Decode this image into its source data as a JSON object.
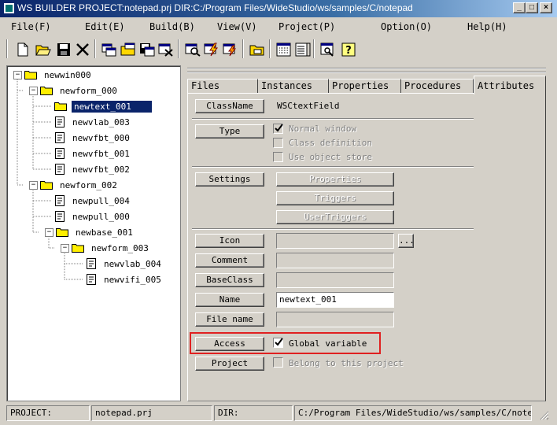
{
  "window": {
    "title": "WS BUILDER PROJECT:notepad.prj DIR:C:/Program Files/WideStudio/ws/samples/C/notepad"
  },
  "menu": [
    "File(F)",
    "Edit(E)",
    "Build(B)",
    "View(V)",
    "Project(P)",
    "Option(O)",
    "Help(H)"
  ],
  "tree": {
    "root": "newwin000",
    "form0": "newform_000",
    "form0_items": [
      "newtext_001",
      "newvlab_003",
      "newvfbt_000",
      "newvfbt_001",
      "newvfbt_002"
    ],
    "form2": "newform_002",
    "form2_items": [
      "newpull_004",
      "newpull_000"
    ],
    "base": "newbase_001",
    "form3": "newform_003",
    "form3_items": [
      "newvlab_004",
      "newvifi_005"
    ]
  },
  "tabs": [
    "Files",
    "Instances",
    "Properties",
    "Procedures",
    "Attributes"
  ],
  "attr": {
    "classname_btn": "ClassName",
    "classname_val": "WSCtextField",
    "type_btn": "Type",
    "type_opts": [
      "Normal window",
      "Class definition",
      "Use object store"
    ],
    "settings_btn": "Settings",
    "properties_btn": "Properties",
    "triggers_btn": "Triggers",
    "usertriggers_btn": "UserTriggers",
    "icon_btn": "Icon",
    "browse_btn": "...",
    "comment_btn": "Comment",
    "baseclass_btn": "BaseClass",
    "name_btn": "Name",
    "name_val": "newtext_001",
    "filename_btn": "File name",
    "access_btn": "Access",
    "access_opt": "Global variable",
    "project_btn": "Project",
    "project_opt": "Belong to this project"
  },
  "status": {
    "project_label": "PROJECT:",
    "project_val": "notepad.prj",
    "dir_label": "DIR:",
    "dir_val": "C:/Program Files/WideStudio/ws/samples/C/note"
  },
  "colors": {
    "titlebar": "#0a246a",
    "selection": "#0a246a",
    "highlight_box": "#e02020",
    "face": "#d4d0c8"
  }
}
